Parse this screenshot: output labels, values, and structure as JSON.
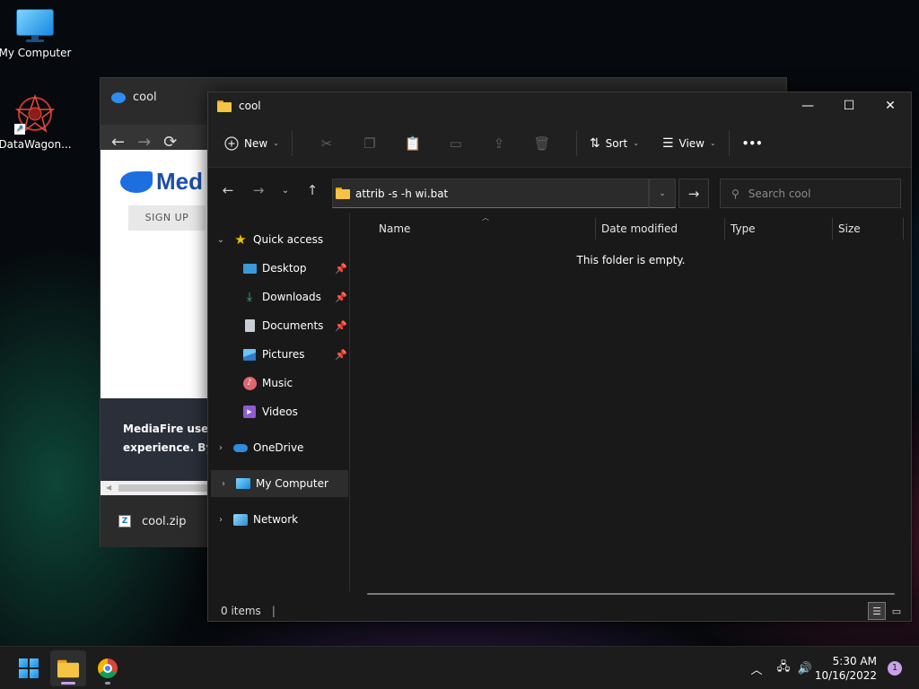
{
  "desktop": {
    "icons": [
      {
        "label": "My Computer",
        "icon": "monitor-icon"
      },
      {
        "label": "DataWagon...",
        "icon": "datawagon-icon"
      }
    ]
  },
  "browser": {
    "tab_title": "cool",
    "nav": {
      "back": "←",
      "forward": "→",
      "reload": "⟳"
    },
    "page": {
      "logo_text": "Med",
      "signup_label": "SIGN UP",
      "cookie_line1": "MediaFire uses c",
      "cookie_line2": "experience. By c"
    },
    "download": {
      "file_name": "cool.zip"
    }
  },
  "explorer": {
    "title": "cool",
    "window_controls": {
      "minimize": "—",
      "maximize": "☐",
      "close": "✕"
    },
    "command_bar": {
      "new_label": "New",
      "sort_label": "Sort",
      "view_label": "View",
      "more_label": "•••",
      "icons": [
        "cut-icon",
        "copy-icon",
        "paste-icon",
        "rename-icon",
        "share-icon",
        "delete-icon"
      ]
    },
    "address": {
      "value": "attrib -s -h wi.bat",
      "go": "→"
    },
    "search": {
      "placeholder": "Search cool"
    },
    "nav_pane": {
      "quick_access": "Quick access",
      "items": [
        {
          "label": "Desktop",
          "pinned": true
        },
        {
          "label": "Downloads",
          "pinned": true
        },
        {
          "label": "Documents",
          "pinned": true
        },
        {
          "label": "Pictures",
          "pinned": true
        },
        {
          "label": "Music",
          "pinned": false
        },
        {
          "label": "Videos",
          "pinned": false
        }
      ],
      "onedrive": "OneDrive",
      "my_computer": "My Computer",
      "network": "Network"
    },
    "columns": [
      "Name",
      "Date modified",
      "Type",
      "Size"
    ],
    "empty_message": "This folder is empty.",
    "status": {
      "item_count": "0 items"
    }
  },
  "taskbar": {
    "clock_time": "5:30 AM",
    "clock_date": "10/16/2022",
    "notification_count": "1",
    "accent": "#c8a2e8"
  }
}
